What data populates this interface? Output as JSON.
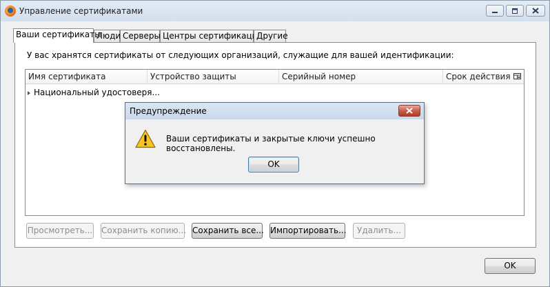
{
  "window": {
    "title": "Управление сертификатами",
    "app_icon": "firefox-icon",
    "controls": [
      "minimize-icon",
      "maximize-icon",
      "close-icon"
    ]
  },
  "tabs": [
    {
      "label": "Ваши сертификаты",
      "active": true
    },
    {
      "label": "Люди",
      "active": false
    },
    {
      "label": "Серверы",
      "active": false
    },
    {
      "label": "Центры сертификации",
      "active": false
    },
    {
      "label": "Другие",
      "active": false
    }
  ],
  "panel": {
    "intro": "У вас хранятся сертификаты от следующих организаций, служащие для вашей идентификации:",
    "columns": [
      "Имя сертификата",
      "Устройство защиты",
      "Серийный номер",
      "Срок действия"
    ],
    "column_picker_icon": "column-picker-icon",
    "rows": [
      {
        "label": "Национальный удостоверя...",
        "expanded": false
      }
    ],
    "buttons": {
      "view": "Просмотреть...",
      "save_copy": "Сохранить копию...",
      "save_all": "Сохранить все...",
      "import": "Импортировать...",
      "delete": "Удалить..."
    }
  },
  "footer": {
    "ok": "OK"
  },
  "alert": {
    "title": "Предупреждение",
    "icon": "warning-icon",
    "message": "Ваши сертификаты и закрытые ключи успешно восстановлены.",
    "ok": "OK"
  },
  "colors": {
    "titlebar": "#d3dfec",
    "close_button": "#c75e4b",
    "warning": "#f7c325"
  }
}
